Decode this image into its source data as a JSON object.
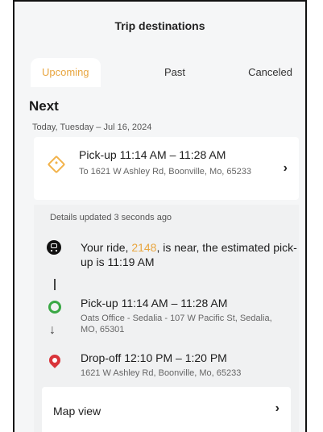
{
  "header": {
    "title": "Trip destinations"
  },
  "tabs": [
    {
      "label": "Upcoming",
      "active": true
    },
    {
      "label": "Past",
      "active": false
    },
    {
      "label": "Canceled",
      "active": false
    }
  ],
  "section": {
    "title": "Next"
  },
  "date_line": "Today, Tuesday – Jul 16, 2024",
  "pickup_card": {
    "title": "Pick-up 11:14 AM – 11:28 AM",
    "address": "To 1621 W Ashley Rd, Boonville, Mo, 65233",
    "icon": "diamond-direction-icon"
  },
  "details": {
    "updated": "Details updated 3 seconds ago",
    "ride_prefix": "Your ride, ",
    "ride_number": "2148",
    "ride_suffix": ", is near, the estimated pick-up is 11:19 AM",
    "pickup": {
      "title": "Pick-up 11:14 AM – 11:28 AM",
      "address": "Oats Office - Sedalia - 107 W Pacific St, Sedalia, MO, 65301"
    },
    "dropoff": {
      "title": "Drop-off 12:10 PM – 1:20 PM",
      "address": "1621 W Ashley Rd, Boonville, Mo, 65233"
    }
  },
  "map_view": {
    "label": "Map view"
  },
  "colors": {
    "accent": "#e8a640",
    "origin_green": "#3aa845",
    "destination_red": "#d9343a",
    "background": "#f5f6f7"
  }
}
